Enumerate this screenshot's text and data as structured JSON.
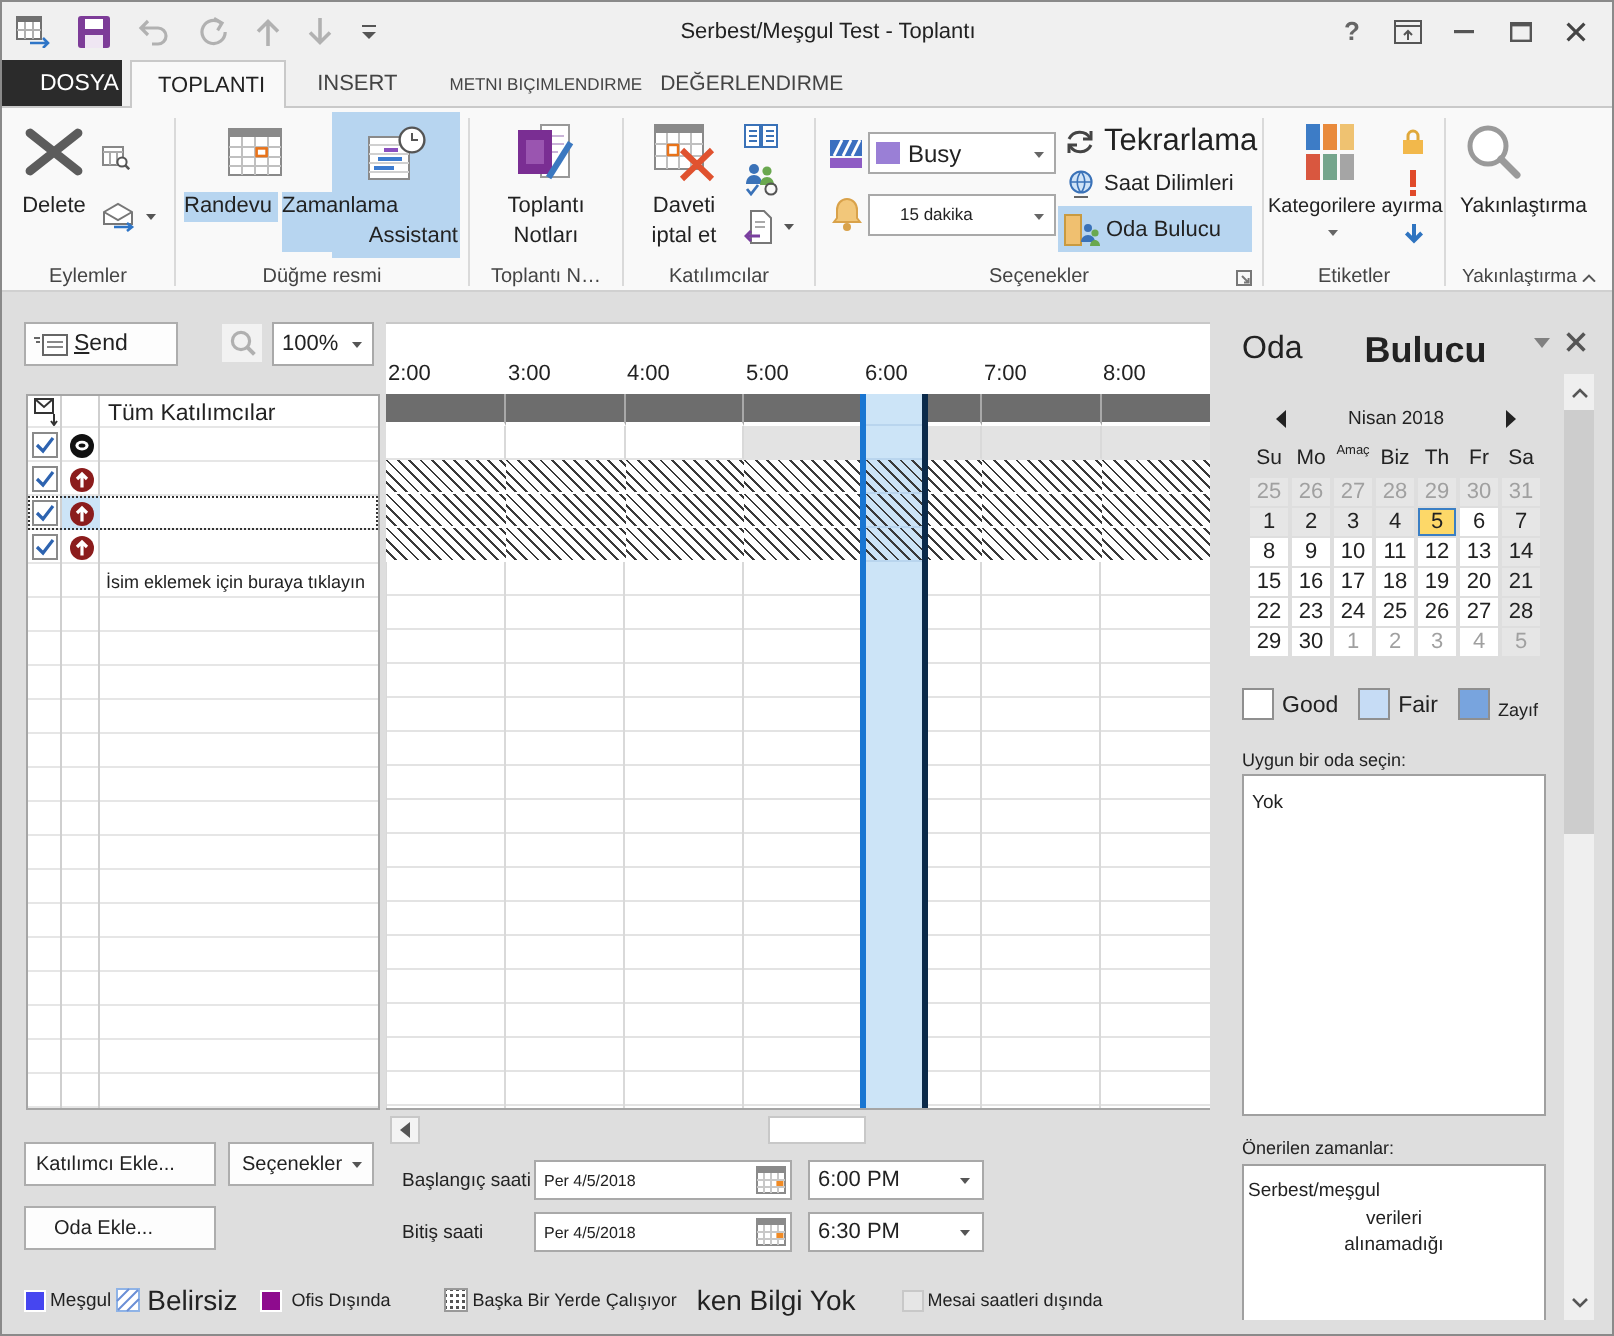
{
  "window": {
    "title": "Serbest/Meşgul Test - Toplantı",
    "help": "?"
  },
  "quick_access": [
    {
      "kind": "app",
      "disabled": false
    },
    {
      "kind": "save",
      "disabled": false
    },
    {
      "kind": "undo",
      "disabled": true
    },
    {
      "kind": "redo",
      "disabled": true
    },
    {
      "kind": "up",
      "disabled": true
    },
    {
      "kind": "down",
      "disabled": true
    },
    {
      "kind": "customize",
      "disabled": false
    }
  ],
  "file_menu": {
    "label": "DOSYA"
  },
  "tabs": [
    {
      "label": "TOPLANTI",
      "selected": true
    },
    {
      "label": "INSERT",
      "selected": false
    },
    {
      "label": "METNI BIÇIMLENDIRME",
      "selected": false
    },
    {
      "label": "DEĞERLENDIRME",
      "selected": false
    }
  ],
  "ribbon": {
    "actions": {
      "label": "Eylemler",
      "delete": "Delete"
    },
    "show": {
      "label": "Düğme resmi",
      "appointment": {
        "label": "Randevu",
        "selected": false
      },
      "assistant": {
        "label": "Zamanlama Assistant",
        "selected": true
      }
    },
    "notes": {
      "label": "Toplantı N…",
      "button": "Toplantı Notları"
    },
    "attendees": {
      "label": "Katılımcılar",
      "cancel": "Daveti iptal et"
    },
    "options": {
      "label": "Seçenekler",
      "show_as": "Busy",
      "reminder": "15 dakika",
      "recurrence": "Tekrarlama",
      "time_zones": "Saat Dilimleri",
      "room_finder": {
        "label": "Oda Bulucu",
        "selected": true
      }
    },
    "tags": {
      "label": "Etiketler",
      "categorize": "Kategorilere ayırma"
    },
    "zoom": {
      "label": "Yakınlaştırma",
      "button": "Yakınlaştırma"
    }
  },
  "scheduling": {
    "send": "Send",
    "zoom": "100%",
    "all_attendees": "Tüm Katılımcılar",
    "time_columns": [
      {
        "label": "2:00",
        "selected": false
      },
      {
        "label": "3:00",
        "selected": false
      },
      {
        "label": "4:00",
        "selected": false
      },
      {
        "label": "5:00",
        "selected": false
      },
      {
        "label": "6:00",
        "selected": true
      },
      {
        "label": "7:00",
        "selected": false
      },
      {
        "label": "8:00",
        "selected": false
      }
    ],
    "summary_slots": [
      {
        "kind": "combined"
      },
      {
        "kind": "combined"
      },
      {
        "kind": "combined"
      },
      {
        "kind": "combined"
      },
      {
        "kind": "combined"
      },
      {
        "kind": "combined"
      },
      {
        "kind": "combined"
      }
    ],
    "attendees": [
      {
        "kind": "organizer",
        "checked": true,
        "selected": false,
        "slots": [
          {
            "kind": "free"
          },
          {
            "kind": "free"
          },
          {
            "kind": "free"
          },
          {
            "kind": "off_hours"
          },
          {
            "kind": "off_hours"
          },
          {
            "kind": "off_hours"
          },
          {
            "kind": "off_hours"
          }
        ]
      },
      {
        "kind": "required",
        "checked": true,
        "selected": false,
        "slots": [
          {
            "kind": "no_info"
          },
          {
            "kind": "no_info"
          },
          {
            "kind": "no_info"
          },
          {
            "kind": "no_info"
          },
          {
            "kind": "no_info"
          },
          {
            "kind": "no_info"
          },
          {
            "kind": "no_info"
          }
        ]
      },
      {
        "kind": "required",
        "checked": true,
        "selected": true,
        "slots": [
          {
            "kind": "no_info"
          },
          {
            "kind": "no_info"
          },
          {
            "kind": "no_info"
          },
          {
            "kind": "no_info"
          },
          {
            "kind": "no_info"
          },
          {
            "kind": "no_info"
          },
          {
            "kind": "no_info"
          }
        ]
      },
      {
        "kind": "required",
        "checked": true,
        "selected": false,
        "slots": [
          {
            "kind": "no_info"
          },
          {
            "kind": "no_info"
          },
          {
            "kind": "no_info"
          },
          {
            "kind": "no_info"
          },
          {
            "kind": "no_info"
          },
          {
            "kind": "no_info"
          },
          {
            "kind": "no_info"
          }
        ]
      }
    ],
    "add_prompt": "İsim eklemek için buraya tıklayın"
  },
  "buttons": {
    "add_attendee": "Katılımcı Ekle...",
    "options": "Seçenekler",
    "add_room": "Oda Ekle..."
  },
  "start": {
    "label": "Başlangıç saati",
    "date": "Per 4/5/2018",
    "time": "6:00 PM"
  },
  "end": {
    "label": "Bitiş saati",
    "date": "Per 4/5/2018",
    "time": "6:30 PM"
  },
  "legend": [
    {
      "kind": "solid",
      "label": "Meşgul",
      "color": "#4646f0"
    },
    {
      "kind": "hatched",
      "label": "Belirsiz"
    },
    {
      "kind": "solid",
      "label": "Ofis Dışında",
      "color": "#8e0b8e"
    },
    {
      "kind": "dotted",
      "label": "Başka Bir Yerde Çalışıyor"
    },
    {
      "kind": "none",
      "label": "ken Bilgi Yok"
    },
    {
      "kind": "solid",
      "label": "Mesai saatleri dışında",
      "color": "#e6e6e6"
    }
  ],
  "room_finder": {
    "title": [
      "Oda",
      "Bulucu"
    ],
    "calendar": {
      "month": "Nisan 2018",
      "weekdays": [
        {
          "label": "Su",
          "kind": "plain"
        },
        {
          "label": "Mo",
          "kind": "plain"
        },
        {
          "label": "Amaç",
          "kind": "raised"
        },
        {
          "label": "Biz",
          "kind": "plain"
        },
        {
          "label": "Th",
          "kind": "plain"
        },
        {
          "label": "Fr",
          "kind": "plain"
        },
        {
          "label": "Sa",
          "kind": "plain"
        }
      ],
      "weeks": [
        [
          {
            "day": "25",
            "muted": true,
            "shaded": true,
            "selected": false
          },
          {
            "day": "26",
            "muted": true,
            "shaded": true,
            "selected": false
          },
          {
            "day": "27",
            "muted": true,
            "shaded": true,
            "selected": false
          },
          {
            "day": "28",
            "muted": true,
            "shaded": true,
            "selected": false
          },
          {
            "day": "29",
            "muted": true,
            "shaded": true,
            "selected": false
          },
          {
            "day": "30",
            "muted": true,
            "shaded": true,
            "selected": false
          },
          {
            "day": "31",
            "muted": true,
            "shaded": true,
            "selected": false
          }
        ],
        [
          {
            "day": "1",
            "muted": false,
            "shaded": true,
            "selected": false
          },
          {
            "day": "2",
            "muted": false,
            "shaded": true,
            "selected": false
          },
          {
            "day": "3",
            "muted": false,
            "shaded": true,
            "selected": false
          },
          {
            "day": "4",
            "muted": false,
            "shaded": true,
            "selected": false
          },
          {
            "day": "5",
            "muted": false,
            "shaded": false,
            "selected": true
          },
          {
            "day": "6",
            "muted": false,
            "shaded": false,
            "selected": false
          },
          {
            "day": "7",
            "muted": false,
            "shaded": true,
            "selected": false
          }
        ],
        [
          {
            "day": "8",
            "muted": false,
            "shaded": false,
            "selected": false
          },
          {
            "day": "9",
            "muted": false,
            "shaded": false,
            "selected": false
          },
          {
            "day": "10",
            "muted": false,
            "shaded": false,
            "selected": false
          },
          {
            "day": "11",
            "muted": false,
            "shaded": false,
            "selected": false
          },
          {
            "day": "12",
            "muted": false,
            "shaded": false,
            "selected": false
          },
          {
            "day": "13",
            "muted": false,
            "shaded": false,
            "selected": false
          },
          {
            "day": "14",
            "muted": false,
            "shaded": true,
            "selected": false
          }
        ],
        [
          {
            "day": "15",
            "muted": false,
            "shaded": false,
            "selected": false
          },
          {
            "day": "16",
            "muted": false,
            "shaded": false,
            "selected": false
          },
          {
            "day": "17",
            "muted": false,
            "shaded": false,
            "selected": false
          },
          {
            "day": "18",
            "muted": false,
            "shaded": false,
            "selected": false
          },
          {
            "day": "19",
            "muted": false,
            "shaded": false,
            "selected": false
          },
          {
            "day": "20",
            "muted": false,
            "shaded": false,
            "selected": false
          },
          {
            "day": "21",
            "muted": false,
            "shaded": true,
            "selected": false
          }
        ],
        [
          {
            "day": "22",
            "muted": false,
            "shaded": false,
            "selected": false
          },
          {
            "day": "23",
            "muted": false,
            "shaded": false,
            "selected": false
          },
          {
            "day": "24",
            "muted": false,
            "shaded": false,
            "selected": false
          },
          {
            "day": "25",
            "muted": false,
            "shaded": false,
            "selected": false
          },
          {
            "day": "26",
            "muted": false,
            "shaded": false,
            "selected": false
          },
          {
            "day": "27",
            "muted": false,
            "shaded": false,
            "selected": false
          },
          {
            "day": "28",
            "muted": false,
            "shaded": true,
            "selected": false
          }
        ],
        [
          {
            "day": "29",
            "muted": false,
            "shaded": false,
            "selected": false
          },
          {
            "day": "30",
            "muted": false,
            "shaded": false,
            "selected": false
          },
          {
            "day": "1",
            "muted": true,
            "shaded": false,
            "selected": false
          },
          {
            "day": "2",
            "muted": true,
            "shaded": false,
            "selected": false
          },
          {
            "day": "3",
            "muted": true,
            "shaded": false,
            "selected": false
          },
          {
            "day": "4",
            "muted": true,
            "shaded": false,
            "selected": false
          },
          {
            "day": "5",
            "muted": true,
            "shaded": true,
            "selected": false
          }
        ]
      ]
    },
    "quality_legend": [
      {
        "label": "Good",
        "color": "#ffffff"
      },
      {
        "label": "Fair",
        "color": "#c6dcf5"
      },
      {
        "label": "Zayıf",
        "color": "#78a4de"
      }
    ],
    "rooms_label": "Uygun bir oda seçin:",
    "rooms": [
      "Yok"
    ],
    "suggestions_label": "Önerilen zamanlar:",
    "suggestions_message": "Serbest/meşgul\nverileri\nalınamadığı"
  }
}
